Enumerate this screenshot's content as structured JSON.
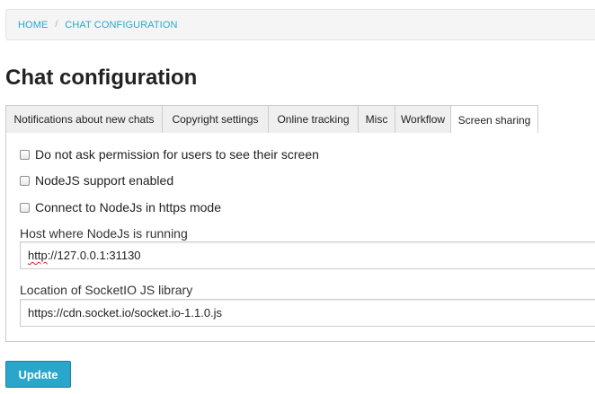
{
  "breadcrumb": {
    "home": "HOME",
    "separator": "/",
    "current": "CHAT CONFIGURATION"
  },
  "page": {
    "title": "Chat configuration"
  },
  "tabs": [
    {
      "label": "Notifications about new chats",
      "active": false
    },
    {
      "label": "Copyright settings",
      "active": false
    },
    {
      "label": "Online tracking",
      "active": false
    },
    {
      "label": "Misc",
      "active": false
    },
    {
      "label": "Workflow",
      "active": false
    },
    {
      "label": "Screen sharing",
      "active": true
    }
  ],
  "screen_sharing": {
    "options": [
      {
        "label": "Do not ask permission for users to see their screen",
        "checked": false
      },
      {
        "label": "NodeJS support enabled",
        "checked": false
      },
      {
        "label": "Connect to NodeJs in https mode",
        "checked": false
      }
    ],
    "host": {
      "label": "Host where NodeJs is running",
      "value_scheme": "http",
      "value_rest": "://127.0.0.1:31130"
    },
    "socketio": {
      "label": "Location of SocketIO JS library",
      "value": "https://cdn.socket.io/socket.io-1.1.0.js"
    }
  },
  "actions": {
    "update_label": "Update"
  },
  "colors": {
    "accent": "#2ba6cb",
    "tab_inactive_bg": "#efefef",
    "border": "#cccccc"
  }
}
